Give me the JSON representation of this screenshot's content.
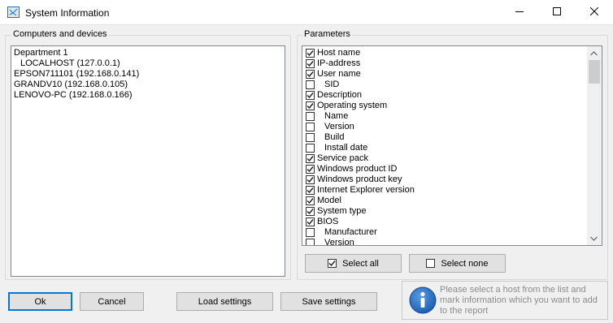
{
  "window": {
    "title": "System Information",
    "app_icon": "network-diagram-icon",
    "controls": [
      "minimize-icon",
      "maximize-icon",
      "close-icon"
    ]
  },
  "computers": {
    "group_label": "Computers and devices",
    "items": [
      "Department 1",
      "LOCALHOST (127.0.0.1)",
      "EPSON711101 (192.168.0.141)",
      "GRANDV10 (192.168.0.105)",
      "LENOVO-PC (192.168.0.166)"
    ]
  },
  "parameters": {
    "group_label": "Parameters",
    "items": [
      {
        "label": "Host name",
        "checked": true,
        "indent": false
      },
      {
        "label": "IP-address",
        "checked": true,
        "indent": false
      },
      {
        "label": "User name",
        "checked": true,
        "indent": false
      },
      {
        "label": "SID",
        "checked": false,
        "indent": true
      },
      {
        "label": "Description",
        "checked": true,
        "indent": false
      },
      {
        "label": "Operating system",
        "checked": true,
        "indent": false
      },
      {
        "label": "Name",
        "checked": false,
        "indent": true
      },
      {
        "label": "Version",
        "checked": false,
        "indent": true
      },
      {
        "label": "Build",
        "checked": false,
        "indent": true
      },
      {
        "label": "Install date",
        "checked": false,
        "indent": true
      },
      {
        "label": "Service pack",
        "checked": true,
        "indent": false
      },
      {
        "label": "Windows product ID",
        "checked": true,
        "indent": false
      },
      {
        "label": "Windows product key",
        "checked": true,
        "indent": false
      },
      {
        "label": "Internet Explorer version",
        "checked": true,
        "indent": false
      },
      {
        "label": "Model",
        "checked": true,
        "indent": false
      },
      {
        "label": "System type",
        "checked": true,
        "indent": false
      },
      {
        "label": "BIOS",
        "checked": true,
        "indent": false
      },
      {
        "label": "Manufacturer",
        "checked": false,
        "indent": true
      },
      {
        "label": "Version",
        "checked": false,
        "indent": true
      }
    ],
    "select_all_label": "Select all",
    "select_all_checked": true,
    "select_none_label": "Select none",
    "select_none_checked": false
  },
  "footer": {
    "ok_label": "Ok",
    "cancel_label": "Cancel",
    "load_label": "Load settings",
    "save_label": "Save settings",
    "info_icon": "info-icon",
    "info_text": "Please select a host from the list and mark information which you want to add to the report"
  },
  "colors": {
    "accent": "#0078d7",
    "info_blue": "#1e5fb4",
    "info_text": "#8c8c8c"
  }
}
